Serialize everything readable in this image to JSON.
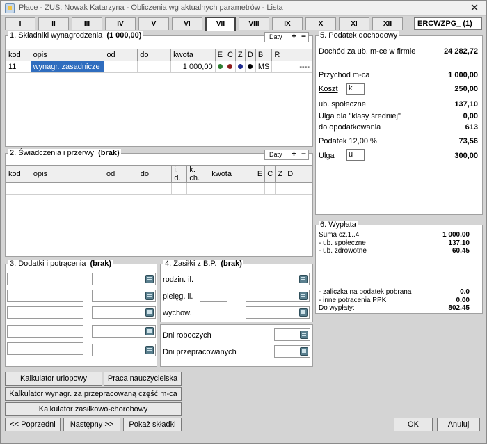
{
  "window": {
    "title": "Płace - ZUS: Nowak Katarzyna - Obliczenia wg aktualnych parametrów - Lista",
    "close": "✕"
  },
  "tabs": [
    "I",
    "II",
    "III",
    "IV",
    "V",
    "VI",
    "VII",
    "VIII",
    "IX",
    "X",
    "XI",
    "XII"
  ],
  "active_tab": "VII",
  "tab_code": "ERCWZPG_ (1)",
  "daty": {
    "label": "Daty",
    "plus": "+",
    "minus": "−"
  },
  "section1": {
    "title": "1. Składniki wynagrodzenia",
    "total": "(1 000,00)",
    "headers": [
      "kod",
      "opis",
      "od",
      "do",
      "kwota",
      "E",
      "C",
      "Z",
      "D",
      "B",
      "R"
    ],
    "row": {
      "kod": "11",
      "opis": "wynagr. zasadnicze",
      "od": "",
      "do": "",
      "kwota": "1 000,00",
      "B": "MS",
      "R": "----"
    },
    "dot_colors": [
      "#2e7d32",
      "#8e1c1c",
      "#1e2a8e",
      "#000000"
    ]
  },
  "section2": {
    "title": "2. Świadczenia i przerwy",
    "status": "(brak)",
    "headers": [
      "kod",
      "opis",
      "od",
      "do",
      "i. d.",
      "k. ch.",
      "kwota",
      "E",
      "C",
      "Z",
      "D"
    ]
  },
  "section3": {
    "title": "3. Dodatki i potrącenia",
    "status": "(brak)"
  },
  "section4": {
    "title": "4. Zasiłki z B.P.",
    "status": "(brak)",
    "labels": [
      "rodzin. il.",
      "pielęg. il.",
      "wychow."
    ]
  },
  "days": {
    "roboczych": "Dni roboczych",
    "przepracowanych": "Dni przepracowanych"
  },
  "section5": {
    "title": "5. Podatek dochodowy",
    "dochod_label": "Dochód za ub. m-ce w firmie",
    "dochod_value": "24 282,72",
    "przychod_label": "Przychód m-ca",
    "przychod_value": "1 000,00",
    "koszt_label": "Koszt",
    "koszt_code": "k",
    "koszt_value": "250,00",
    "ub_label": "ub. społeczne",
    "ub_value": "137,10",
    "ulga_klasy_label": "Ulga dla \"klasy średniej\"",
    "ulga_klasy_value": "0,00",
    "do_opod_label": "do opodatkowania",
    "do_opod_value": "613",
    "podatek_label": "Podatek 12,00 %",
    "podatek_value": "73,56",
    "ulga_label": "Ulga",
    "ulga_code": "u",
    "ulga_value": "300,00"
  },
  "section6": {
    "title": "6. Wypłata",
    "rows": [
      {
        "label": "Suma cz.1..4",
        "value": "1 000.00"
      },
      {
        "label": "- ub. społeczne",
        "value": "137.10"
      },
      {
        "label": "- ub. zdrowotne",
        "value": "60.45"
      }
    ],
    "rows2": [
      {
        "label": "- zaliczka na podatek pobrana",
        "value": "0.0"
      },
      {
        "label": "- inne potrącenia PPK",
        "value": "0.00"
      },
      {
        "label": "Do wypłaty:",
        "value": "802.45"
      }
    ]
  },
  "buttons": {
    "kalk_urlopowy": "Kalkulator urlopowy",
    "praca_nauczycielska": "Praca nauczycielska",
    "kalk_wynagr": "Kalkulator wynagr. za przepracowaną część m-ca",
    "kalk_zasilkowo": "Kalkulator zasiłkowo-chorobowy",
    "poprzedni": "<< Poprzedni",
    "nastepny": "Następny >>",
    "pokaz": "Pokaż składki",
    "ok": "OK",
    "anuluj": "Anuluj"
  }
}
